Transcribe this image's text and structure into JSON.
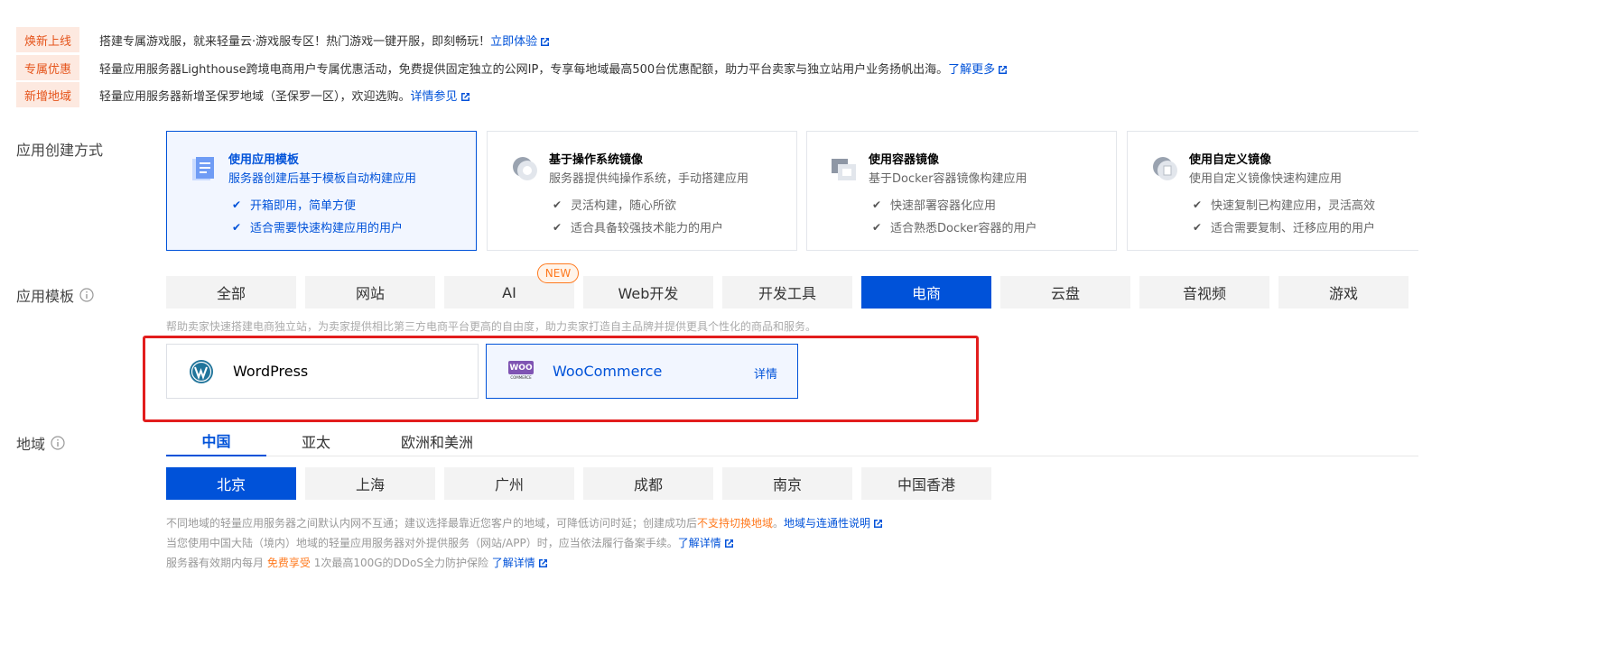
{
  "notices": [
    {
      "badge": "焕新上线",
      "text": "搭建专属游戏服，就来轻量云·游戏服专区！热门游戏一键开服，即刻畅玩！",
      "link": "立即体验"
    },
    {
      "badge": "专属优惠",
      "text": "轻量应用服务器Lighthouse跨境电商用户专属优惠活动，免费提供固定独立的公网IP，专享每地域最高500台优惠配额，助力平台卖家与独立站用户业务扬帆出海。",
      "link": "了解更多"
    },
    {
      "badge": "新增地域",
      "text": "轻量应用服务器新增圣保罗地域（圣保罗一区），欢迎选购。",
      "link": "详情参见"
    }
  ],
  "creation": {
    "label": "应用创建方式",
    "methods": [
      {
        "title": "使用应用模板",
        "desc": "服务器创建后基于模板自动构建应用",
        "features": [
          "开箱即用，简单方便",
          "适合需要快速构建应用的用户"
        ],
        "icon": "template-icon"
      },
      {
        "title": "基于操作系统镜像",
        "desc": "服务器提供纯操作系统，手动搭建应用",
        "features": [
          "灵活构建，随心所欲",
          "适合具备较强技术能力的用户"
        ],
        "icon": "os-image-icon"
      },
      {
        "title": "使用容器镜像",
        "desc": "基于Docker容器镜像构建应用",
        "features": [
          "快速部署容器化应用",
          "适合熟悉Docker容器的用户"
        ],
        "icon": "container-image-icon"
      },
      {
        "title": "使用自定义镜像",
        "desc": "使用自定义镜像快速构建应用",
        "features": [
          "快速复制已构建应用，灵活高效",
          "适合需要复制、迁移应用的用户"
        ],
        "icon": "custom-image-icon"
      }
    ]
  },
  "templates": {
    "label": "应用模板",
    "categories": [
      "全部",
      "网站",
      "AI",
      "Web开发",
      "开发工具",
      "电商",
      "云盘",
      "音视频",
      "游戏"
    ],
    "new_badge": "NEW",
    "helper": "帮助卖家快速搭建电商独立站，为卖家提供相比第三方电商平台更高的自由度，助力卖家打造自主品牌并提供更具个性化的商品和服务。",
    "apps": [
      {
        "name": "WordPress"
      },
      {
        "name": "WooCommerce",
        "logo_text": "WOO",
        "logo_sub": "COMMERCE",
        "detail": "详情"
      }
    ]
  },
  "region": {
    "label": "地域",
    "tabs": [
      "中国",
      "亚太",
      "欧洲和美洲"
    ],
    "cities": [
      "北京",
      "上海",
      "广州",
      "成都",
      "南京",
      "中国香港"
    ],
    "tip1_a": "不同地域的轻量应用服务器之间默认内网不互通；建议选择最靠近您客户的地域，可降低访问时延；创建成功后",
    "tip1_warn": "不支持切换地域",
    "tip1_b": "。",
    "tip1_link": "地域与连通性说明",
    "tip2": "当您使用中国大陆（境内）地域的轻量应用服务器对外提供服务（网站/APP）时，应当依法履行备案手续。",
    "tip2_link": "了解详情",
    "tip3_a": "服务器有效期内每月",
    "tip3_free": "免费享受",
    "tip3_b": "1次最高100G的DDoS全力防护保险",
    "tip3_link": "了解详情"
  },
  "colors": {
    "brand": "#0052d9",
    "warn": "#ff7a1f",
    "badge_bg": "#fde9e0",
    "badge_text": "#e5541b",
    "highlight": "#e21d1d"
  }
}
